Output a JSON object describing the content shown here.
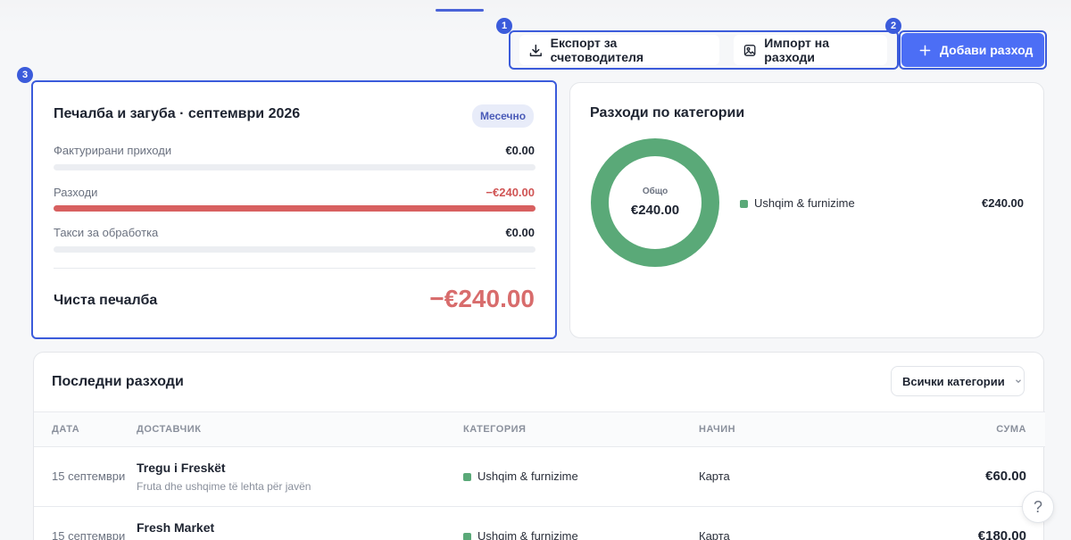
{
  "toolbar": {
    "export_label": "Експорт за счетоводителя",
    "import_label": "Импорт на разходи",
    "add_label": "Добави разход"
  },
  "annotations": [
    "1",
    "2",
    "3"
  ],
  "pl": {
    "title": "Печалба и загуба · септември 2026",
    "period_badge": "Месечно",
    "rows": [
      {
        "label": "Фактурирани приходи",
        "value": "€0.00",
        "fill": 0
      },
      {
        "label": "Разходи",
        "value": "−€240.00",
        "fill": 1
      },
      {
        "label": "Такси за обработка",
        "value": "€0.00",
        "fill": 0
      }
    ],
    "net_label": "Чиста печалба",
    "net_value": "−€240.00"
  },
  "categories": {
    "title": "Разходи по категории",
    "total_label": "Общо",
    "total_value": "€240.00",
    "items": [
      {
        "name": "Ushqim & furnizime",
        "value": "€240.00",
        "color": "#5aa978"
      }
    ]
  },
  "expenses": {
    "title": "Последни разходи",
    "filter_label": "Всички категории",
    "columns": {
      "date": "ДАТА",
      "vendor": "ДОСТАВЧИК",
      "category": "КАТЕГОРИЯ",
      "method": "НАЧИН",
      "amount": "СУМА"
    },
    "rows": [
      {
        "date": "15 септември",
        "vendor": "Tregu i Freskët",
        "note": "Fruta dhe ushqime të lehta për javën",
        "category": "Ushqim & furnizime",
        "method": "Карта",
        "amount": "€60.00"
      },
      {
        "date": "15 септември",
        "vendor": "Fresh Market",
        "note": "",
        "category": "Ushqim & furnizime",
        "method": "Карта",
        "amount": "€180.00"
      }
    ]
  },
  "colors": {
    "accent": "#4c6ef5",
    "negative": "#d05555",
    "category_green": "#5aa978"
  },
  "help_icon": "question-icon"
}
